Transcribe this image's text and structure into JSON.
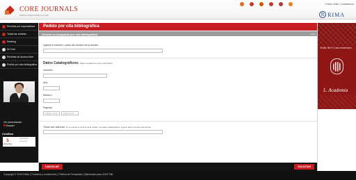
{
  "header": {
    "logo_title": "CORE JOURNALS",
    "logo_subtitle": "WWW.COREJOURNALS.COM",
    "top_links": "Portal | Salir | Contáctenos",
    "rima_letter": "R",
    "rima_text": "RIMA"
  },
  "sidebar": {
    "items": [
      {
        "label": "Revistas por especialidad",
        "icon": "book-icon"
      },
      {
        "label": "Todas las revistas",
        "icon": "list-icon"
      },
      {
        "label": "Ranking",
        "icon": "chart-icon"
      },
      {
        "label": "Mi Core",
        "icon": "user-icon"
      },
      {
        "label": "Revistas de Acceso libre",
        "icon": "unlock-icon"
      },
      {
        "label": "Pedido por cita bibliografica",
        "icon": "document-icon"
      }
    ],
    "presentation_line1": "Ver presentación",
    "presentation_line2": "Dossier",
    "credits_title": "Créditos",
    "credits_number": "5",
    "credits_label": "Disponibles",
    "credits_side_line1": "Actualizado",
    "credits_side_line2": "a la fecha"
  },
  "main": {
    "title": "Pedido por cita bibliográfica",
    "subtitle": "Oriente su búsqueda por cita bibliográfica",
    "back_link": "volver",
    "journal_label": "Ingrese el nombre o parte del nombre de la revista:",
    "journal_value": "",
    "catalog_title": "Datos Catalográficos:",
    "catalog_hint": "Debe completar los todo el formulario",
    "volume_label": "Volumen:",
    "year_label": "Año:",
    "number_label": "Número:",
    "pages_label": "Páginas:",
    "page_start_placeholder": "Página inicial",
    "page_end_placeholder": "Página final",
    "article_label": "Título del artículo:",
    "article_hint": "Si no conoce el nombre de la revista y los datos catalográficos, ingrese aquí el nombre del artículo",
    "cancel_label": "CANCELAR",
    "submit_label": "SOLICITAR"
  },
  "banner": {
    "line1": "Aula del Conocimiento",
    "line2": "L. Academia"
  },
  "footer": {
    "text": "Copyright © 2010 RIMA | Términos y condiciones | Política de Privacidad | Optimizado para 1024*768"
  },
  "colors": {
    "accent_red": "#c61d21",
    "sidebar_black": "#141414",
    "banner_red": "#8e1715",
    "rima_blue": "#224a86"
  }
}
